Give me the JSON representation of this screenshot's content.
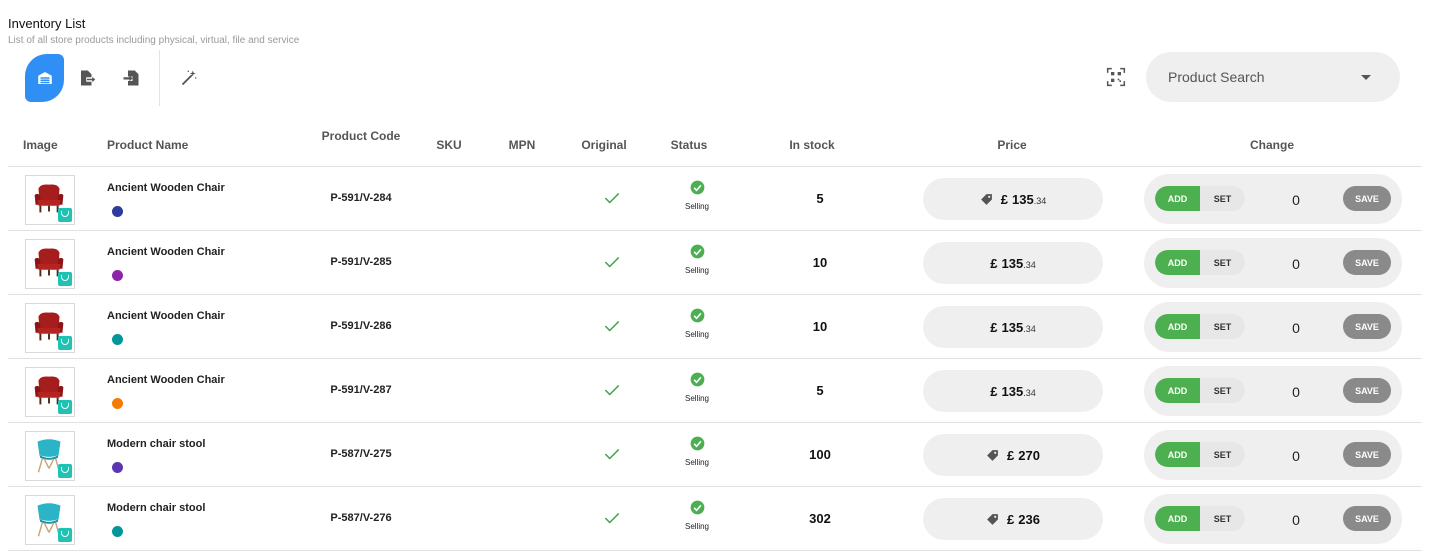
{
  "header": {
    "title": "Inventory List",
    "subtitle": "List of all store products including physical, virtual, file and service"
  },
  "toolbar": {
    "buttons": [
      "warehouse-icon",
      "export-icon",
      "import-icon",
      "magic-wand-icon"
    ],
    "active_color": "#2f8ff5"
  },
  "search": {
    "label": "Product Search"
  },
  "table": {
    "columns": {
      "image": "Image",
      "product_name": "Product Name",
      "product_code": "Product Code",
      "sku": "SKU",
      "mpn": "MPN",
      "original": "Original",
      "status": "Status",
      "in_stock": "In stock",
      "price": "Price",
      "change": "Change"
    },
    "rows": [
      {
        "name": "Ancient Wooden Chair",
        "color": "#2e3a9e",
        "code": "P-591/V-284",
        "status": "Selling",
        "stock": "5",
        "show_tag": true,
        "currency": "£",
        "price": "135",
        "price_decimal": ".34",
        "mode_add": "ADD",
        "mode_set": "SET",
        "qty": "0",
        "save": "SAVE",
        "image": "red-chair"
      },
      {
        "name": "Ancient Wooden Chair",
        "color": "#8e24aa",
        "code": "P-591/V-285",
        "status": "Selling",
        "stock": "10",
        "show_tag": false,
        "currency": "£",
        "price": "135",
        "price_decimal": ".34",
        "mode_add": "ADD",
        "mode_set": "SET",
        "qty": "0",
        "save": "SAVE",
        "image": "red-chair"
      },
      {
        "name": "Ancient Wooden Chair",
        "color": "#00979a",
        "code": "P-591/V-286",
        "status": "Selling",
        "stock": "10",
        "show_tag": false,
        "currency": "£",
        "price": "135",
        "price_decimal": ".34",
        "mode_add": "ADD",
        "mode_set": "SET",
        "qty": "0",
        "save": "SAVE",
        "image": "red-chair"
      },
      {
        "name": "Ancient Wooden Chair",
        "color": "#f57c00",
        "code": "P-591/V-287",
        "status": "Selling",
        "stock": "5",
        "show_tag": false,
        "currency": "£",
        "price": "135",
        "price_decimal": ".34",
        "mode_add": "ADD",
        "mode_set": "SET",
        "qty": "0",
        "save": "SAVE",
        "image": "red-chair"
      },
      {
        "name": "Modern chair stool",
        "color": "#5e35b1",
        "code": "P-587/V-275",
        "status": "Selling",
        "stock": "100",
        "show_tag": true,
        "currency": "£",
        "price": "270",
        "price_decimal": "",
        "mode_add": "ADD",
        "mode_set": "SET",
        "qty": "0",
        "save": "SAVE",
        "image": "teal-chair"
      },
      {
        "name": "Modern chair stool",
        "color": "#00979a",
        "code": "P-587/V-276",
        "status": "Selling",
        "stock": "302",
        "show_tag": true,
        "currency": "£",
        "price": "236",
        "price_decimal": "",
        "mode_add": "ADD",
        "mode_set": "SET",
        "qty": "0",
        "save": "SAVE",
        "image": "teal-chair"
      }
    ]
  },
  "colors": {
    "accent": "#2f8ff5",
    "success": "#4caf50",
    "check": "#43a047",
    "save": "#8a8a8a",
    "pill": "#efefef"
  }
}
